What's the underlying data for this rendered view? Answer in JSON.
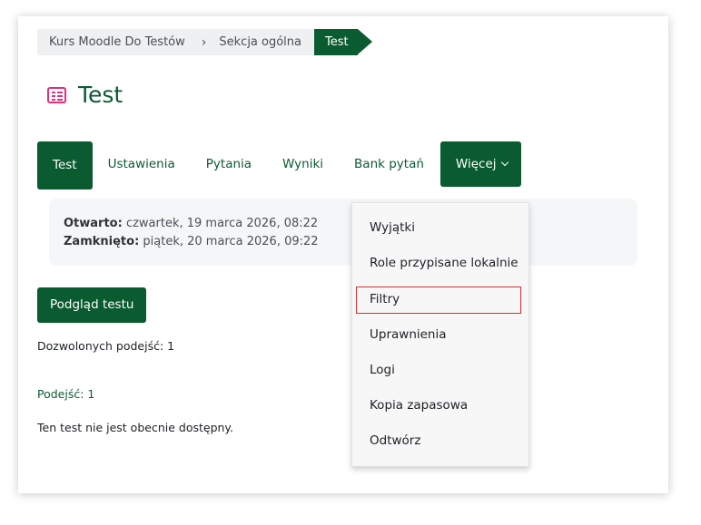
{
  "breadcrumb": {
    "course": "Kurs Moodle Do Testów",
    "separator": "›",
    "section": "Sekcja ogólna",
    "current": "Test"
  },
  "page": {
    "icon": "quiz-icon",
    "title": "Test"
  },
  "tabs": [
    {
      "label": "Test",
      "active": true
    },
    {
      "label": "Ustawienia"
    },
    {
      "label": "Pytania"
    },
    {
      "label": "Wyniki"
    },
    {
      "label": "Bank pytań"
    },
    {
      "label": "Więcej",
      "dropdown": true
    }
  ],
  "info": {
    "open_label": "Otwarto:",
    "open_value": "czwartek, 19 marca 2026, 08:22",
    "closed_label": "Zamknięto:",
    "closed_value": "piątek, 20 marca 2026, 09:22"
  },
  "actions": {
    "preview_button": "Podgląd testu"
  },
  "summary": {
    "allowed_attempts": "Dozwolonych podejść: 1",
    "attempts_link": "Podejść: 1",
    "availability": "Ten test nie jest obecnie dostępny."
  },
  "more_menu": {
    "items": [
      "Wyjątki",
      "Role przypisane lokalnie",
      "Filtry",
      "Uprawnienia",
      "Logi",
      "Kopia zapasowa",
      "Odtwórz"
    ],
    "highlighted": "Filtry"
  },
  "colors": {
    "brand": "#0a5b2f",
    "icon_accent": "#e0307a",
    "highlight_border": "#d93131"
  }
}
